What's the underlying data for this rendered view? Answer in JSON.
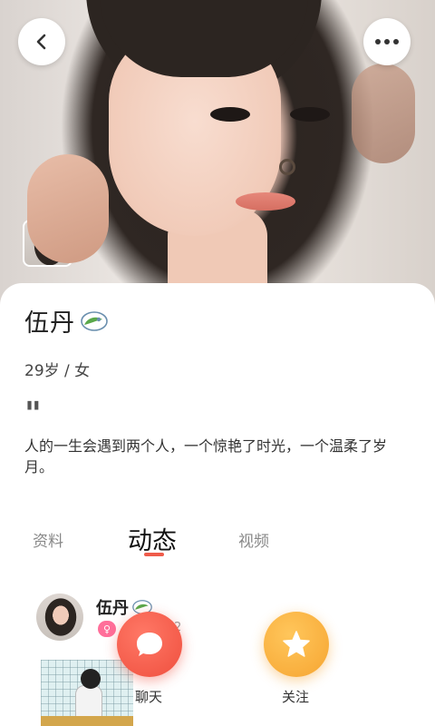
{
  "header": {
    "back_icon": "chevron-left-icon",
    "more_icon": "more-horizontal-icon"
  },
  "profile": {
    "name": "伍丹",
    "badge_icon": "leaf-badge-icon",
    "age_gender": "29岁 / 女",
    "quote_mark": "\"",
    "bio": "人的一生会遇到两个人，一个惊艳了时光，一个温柔了岁月。"
  },
  "tabs": [
    {
      "label": "资料",
      "active": false
    },
    {
      "label": "动态",
      "active": true
    },
    {
      "label": "视频",
      "active": false
    }
  ],
  "post": {
    "author": "伍丹",
    "gender_symbol": "♀",
    "meta_partial": "2"
  },
  "actions": {
    "chat_label": "聊天",
    "follow_label": "关注"
  },
  "colors": {
    "accent_red": "#ef4f3e",
    "accent_orange": "#f6a531",
    "gender_pink": "#ff6f9a",
    "badge_green": "#5aa84a"
  }
}
